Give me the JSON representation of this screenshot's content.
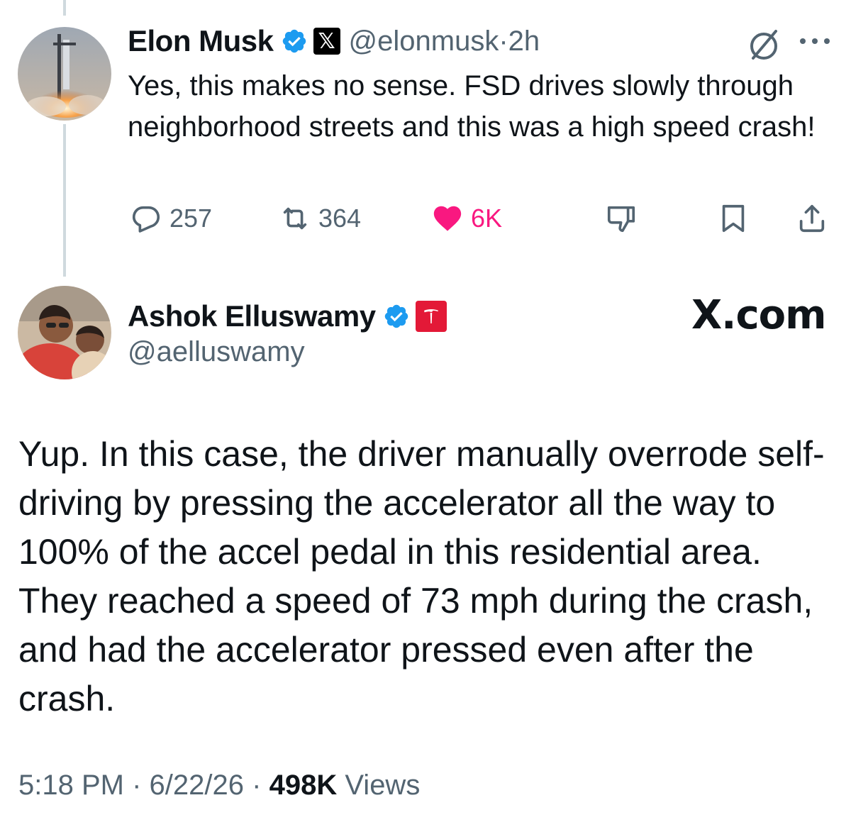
{
  "parent": {
    "name": "Elon Musk",
    "handle": "@elonmusk",
    "separator": "·",
    "time": "2h",
    "text": "Yes, this makes no sense. FSD drives slowly through neighborhood streets and this was a high speed crash!",
    "stats": {
      "replies": "257",
      "reposts": "364",
      "likes": "6K"
    },
    "badges": [
      "verified-badge",
      "x-affiliate-badge"
    ],
    "x_badge_glyph": "𝕏"
  },
  "reply": {
    "name": "Ashok Elluswamy",
    "handle": "@aelluswamy",
    "badges": [
      "verified-badge",
      "tesla-affiliate-badge"
    ],
    "watermark": "X.com",
    "text": "Yup. In this case, the driver manually overrode self-driving by pressing the accelerator all the way to 100% of the accel pedal in this residential area. They reached a speed of 73 mph during the crash, and had the accelerator pressed even after the crash.",
    "time": "5:18 PM",
    "date": "6/22/26",
    "dot": "·",
    "views_count": "498K",
    "views_label": "Views"
  },
  "colors": {
    "text": "#0f1419",
    "secondary": "#536471",
    "verified": "#1d9bf0",
    "like": "#f91880",
    "tesla": "#e31937",
    "thread_line": "#cfd9de"
  },
  "icons": [
    "grok-icon",
    "more-icon",
    "reply-icon",
    "repost-icon",
    "like-icon",
    "dislike-icon",
    "bookmark-icon",
    "share-icon"
  ]
}
